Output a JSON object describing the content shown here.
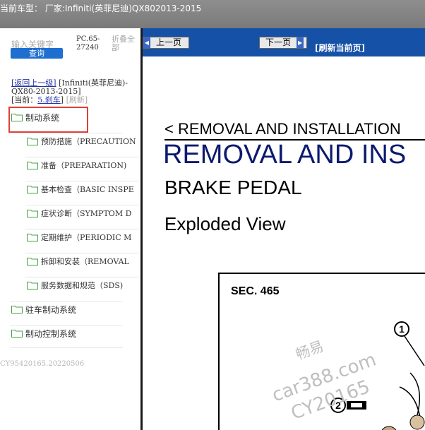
{
  "header": {
    "title": "当前车型：  厂家:Infiniti(英菲尼迪)QX802013-2015"
  },
  "sidebar": {
    "search_placeholder": "输入关键字",
    "search_button": "查询",
    "pc_code": "PC.65-27240",
    "fold_all": "折叠全部",
    "breadcrumb": {
      "back": "[返回上一级]",
      "vehicle": "[Infiniti(英菲尼迪)-QX80-2013-2015]",
      "current_prefix": "[当前：",
      "current": "5.刹车",
      "current_suffix": "]",
      "refresh": "[刷新]"
    },
    "tree": [
      {
        "label": "制动系统",
        "level": 0
      },
      {
        "label": "预防措施（PRECAUTION",
        "level": 1
      },
      {
        "label": "准备（PREPARATION)",
        "level": 1
      },
      {
        "label": "基本检查（BASIC INSPE",
        "level": 1
      },
      {
        "label": "症状诊断（SYMPTOM D",
        "level": 1
      },
      {
        "label": "定期维护（PERIODIC M",
        "level": 1
      },
      {
        "label": "拆卸和安装（REMOVAL",
        "level": 1
      },
      {
        "label": "服务数据和规范（SDS)",
        "level": 1
      },
      {
        "label": "驻车制动系统",
        "level": 0
      },
      {
        "label": "制动控制系统",
        "level": 0
      }
    ],
    "footer_code": "CY95420165.20220506"
  },
  "nav": {
    "prev": "上一页",
    "next": "下一页",
    "refresh": "[刷新当前页]"
  },
  "document": {
    "breadcrumb_title": "< REMOVAL AND INSTALLATION",
    "section_title": "REMOVAL AND INS",
    "subject": "BRAKE PEDAL",
    "view": "Exploded View",
    "figure": {
      "sec": "SEC. 465",
      "callout_1": "1",
      "callout_2": "2"
    }
  },
  "watermark": {
    "line1": "畅易",
    "line2": "car388.com",
    "line3": "CY20165"
  },
  "colors": {
    "topbar": "#888888",
    "navbar": "#1551a7",
    "doc_title": "#0c1a6e",
    "highlight": "#e0403a",
    "folder": "#4caf50"
  }
}
